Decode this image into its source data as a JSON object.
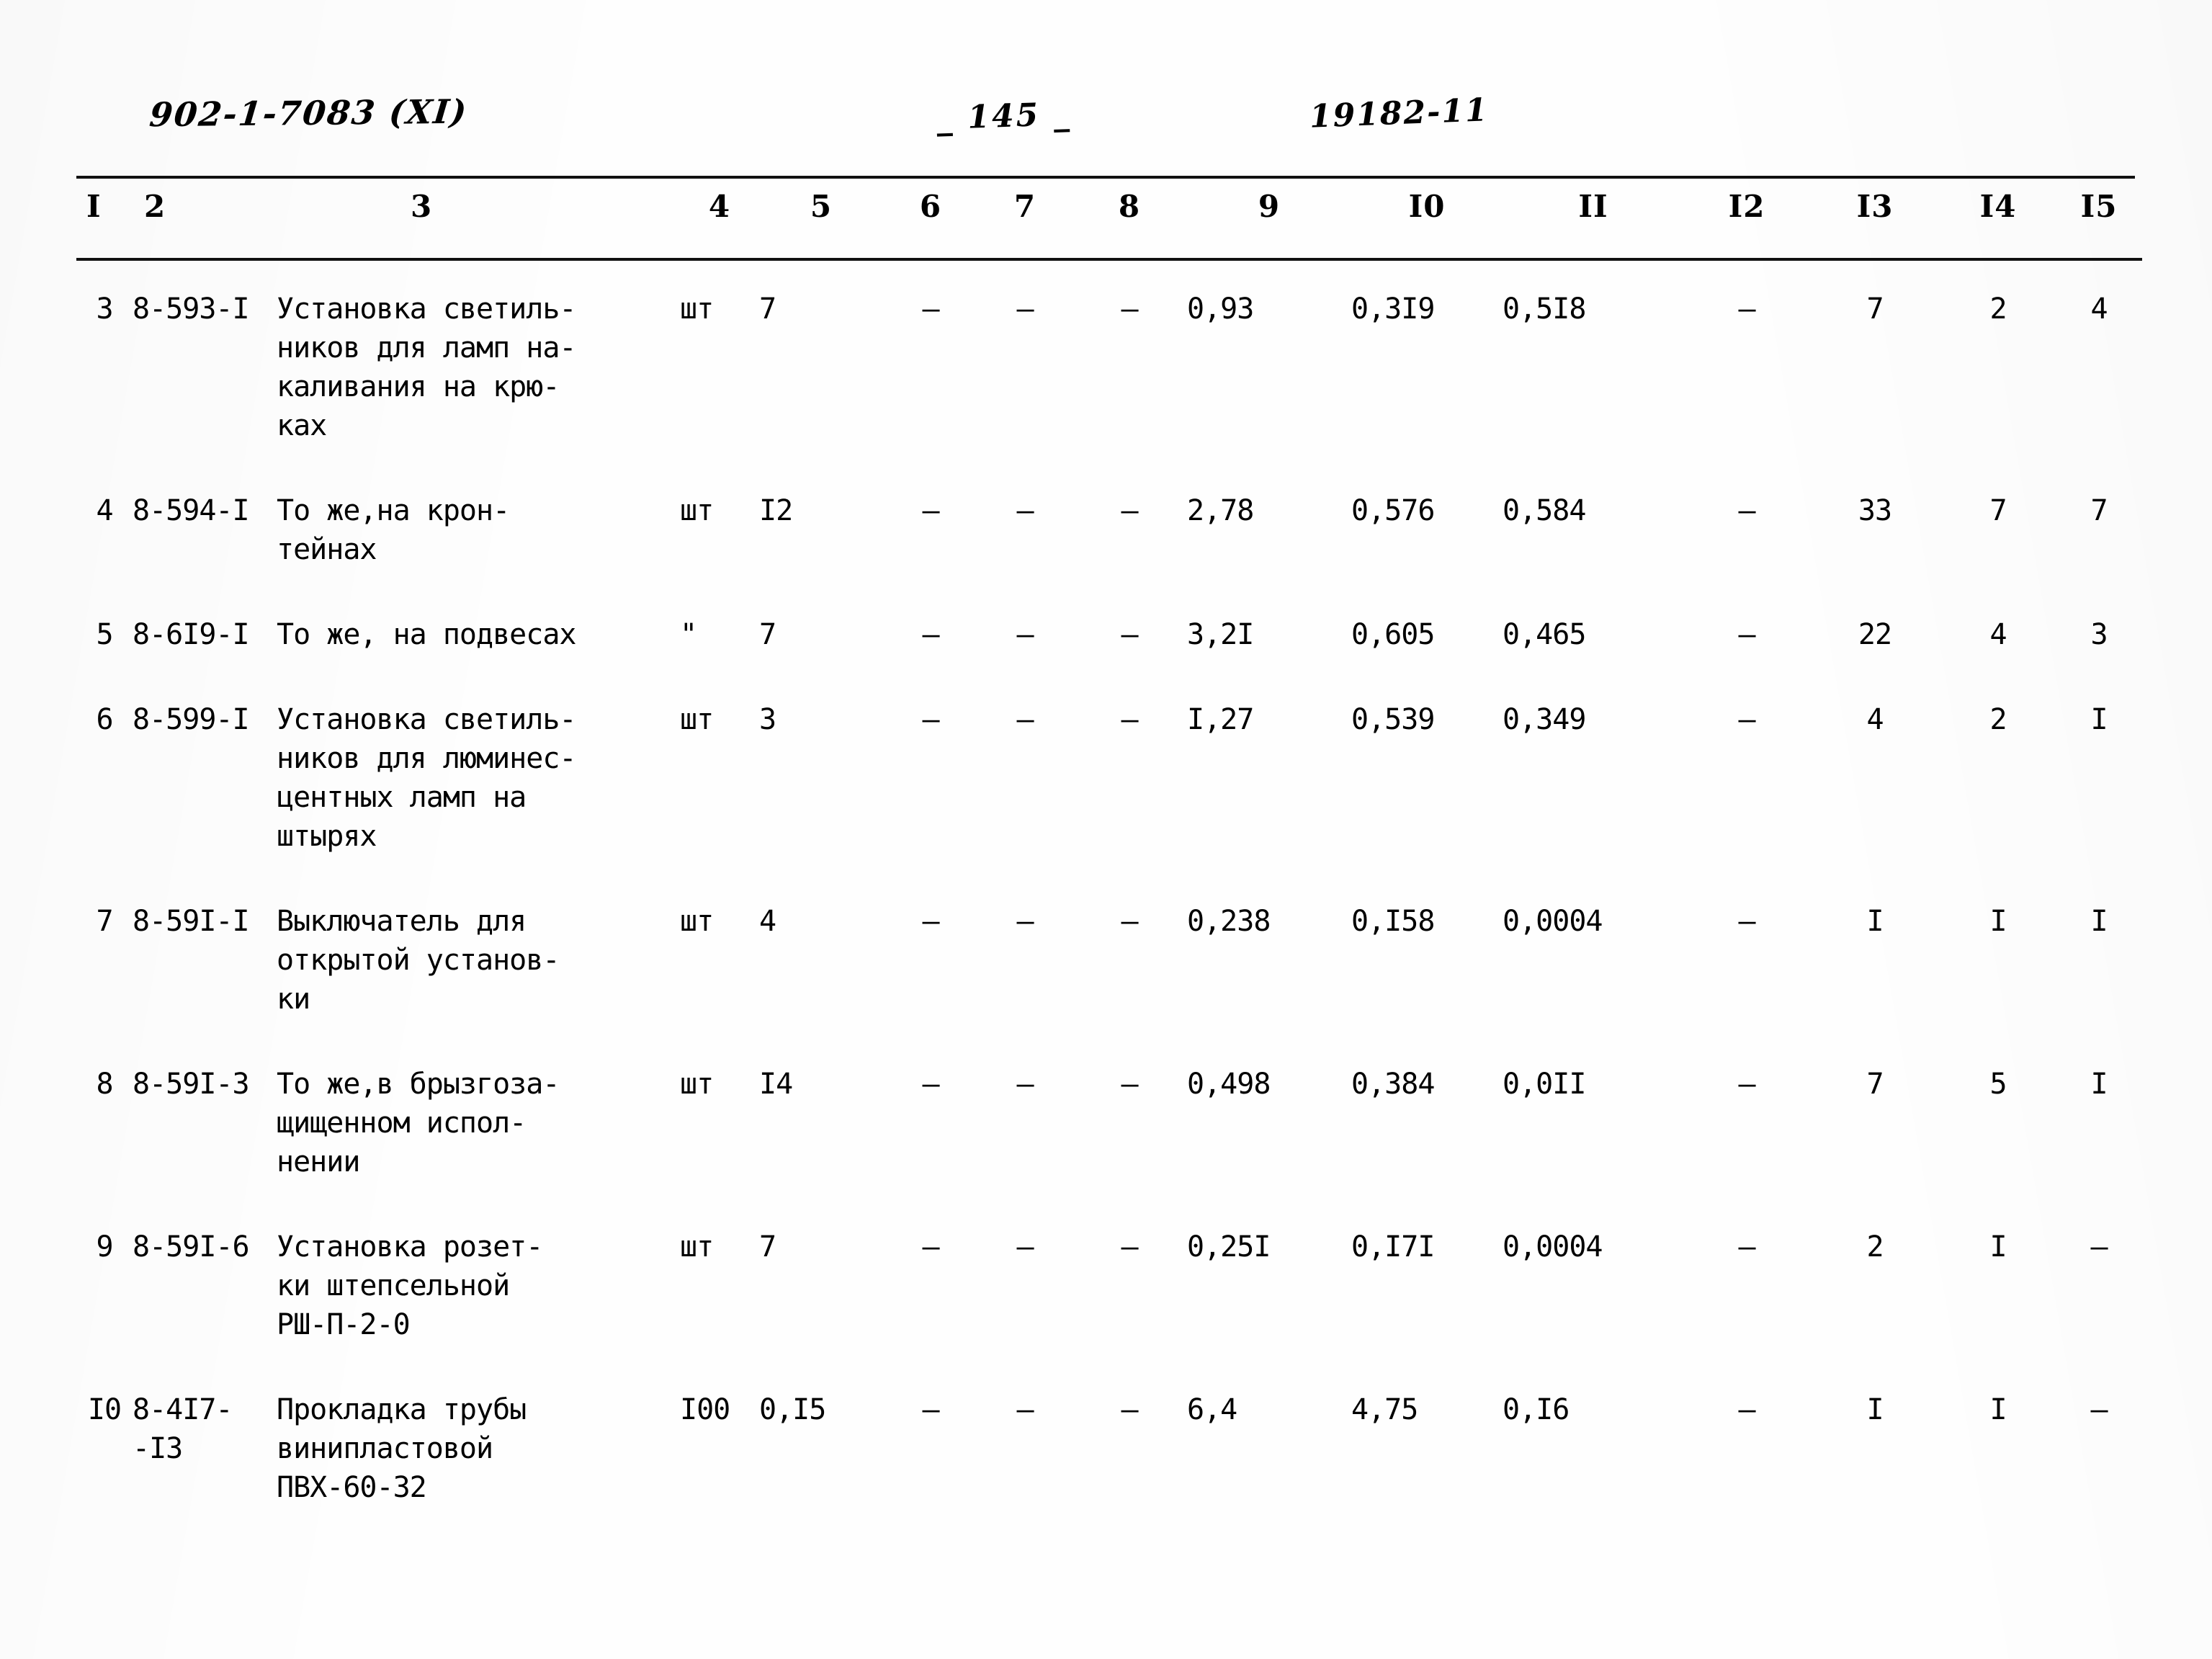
{
  "header": {
    "doc_code": "902-1-7083 (XI)",
    "page_marker": "_  145  _",
    "sheet_number": "19182-11"
  },
  "table": {
    "column_headers": [
      "I",
      "2",
      "3",
      "4",
      "5",
      "6",
      "7",
      "8",
      "9",
      "I0",
      "II",
      "I2",
      "I3",
      "I4",
      "I5"
    ],
    "rows": [
      {
        "no": "3",
        "code": "8-593-I",
        "name": "Установка светиль-\nников для ламп на-\nкаливания на крю-\nках",
        "unit": "шт",
        "qty": "7",
        "c6": "–",
        "c7": "–",
        "c8": "–",
        "c9": "0,93",
        "c10": "0,3I9",
        "c11": "0,5I8",
        "c12": "–",
        "c13": "7",
        "c14": "2",
        "c15": "4"
      },
      {
        "no": "4",
        "code": "8-594-I",
        "name": "То же,на крон-\nтейнах",
        "unit": "шт",
        "qty": "I2",
        "c6": "–",
        "c7": "–",
        "c8": "–",
        "c9": "2,78",
        "c10": "0,576",
        "c11": "0,584",
        "c12": "–",
        "c13": "33",
        "c14": "7",
        "c15": "7"
      },
      {
        "no": "5",
        "code": "8-6I9-I",
        "name": "То же, на подвесах",
        "unit": "\"",
        "qty": "7",
        "c6": "–",
        "c7": "–",
        "c8": "–",
        "c9": "3,2I",
        "c10": "0,605",
        "c11": "0,465",
        "c12": "–",
        "c13": "22",
        "c14": "4",
        "c15": "3"
      },
      {
        "no": "6",
        "code": "8-599-I",
        "name": "Установка светиль-\nников для люминес-\nцентных ламп на\nштырях",
        "unit": "шт",
        "qty": "3",
        "c6": "–",
        "c7": "–",
        "c8": "–",
        "c9": "I,27",
        "c10": "0,539",
        "c11": "0,349",
        "c12": "–",
        "c13": "4",
        "c14": "2",
        "c15": "I"
      },
      {
        "no": "7",
        "code": "8-59I-I",
        "name": "Выключатель для\nоткрытой установ-\nки",
        "unit": "шт",
        "qty": "4",
        "c6": "–",
        "c7": "–",
        "c8": "–",
        "c9": "0,238",
        "c10": "0,I58",
        "c11": "0,0004",
        "c12": "–",
        "c13": "I",
        "c14": "I",
        "c15": "I"
      },
      {
        "no": "8",
        "code": "8-59I-3",
        "name": "То же,в брызгоза-\nщищенном испол-\nнении",
        "unit": "шт",
        "qty": "I4",
        "c6": "–",
        "c7": "–",
        "c8": "–",
        "c9": "0,498",
        "c10": "0,384",
        "c11": "0,0II",
        "c12": "–",
        "c13": "7",
        "c14": "5",
        "c15": "I"
      },
      {
        "no": "9",
        "code": "8-59I-6",
        "name": "Установка розет-\nки штепсельной\nРШ-П-2-0",
        "unit": "шт",
        "qty": "7",
        "c6": "–",
        "c7": "–",
        "c8": "–",
        "c9": "0,25I",
        "c10": "0,I7I",
        "c11": "0,0004",
        "c12": "–",
        "c13": "2",
        "c14": "I",
        "c15": "–"
      },
      {
        "no": "I0",
        "code": "8-4I7-\n-I3",
        "name": "Прокладка трубы\nвинипластовой\nПВХ-60-32",
        "unit": "I00",
        "qty": "0,I5",
        "c6": "–",
        "c7": "–",
        "c8": "–",
        "c9": "6,4",
        "c10": "4,75",
        "c11": "0,I6",
        "c12": "–",
        "c13": "I",
        "c14": "I",
        "c15": "–"
      }
    ]
  }
}
